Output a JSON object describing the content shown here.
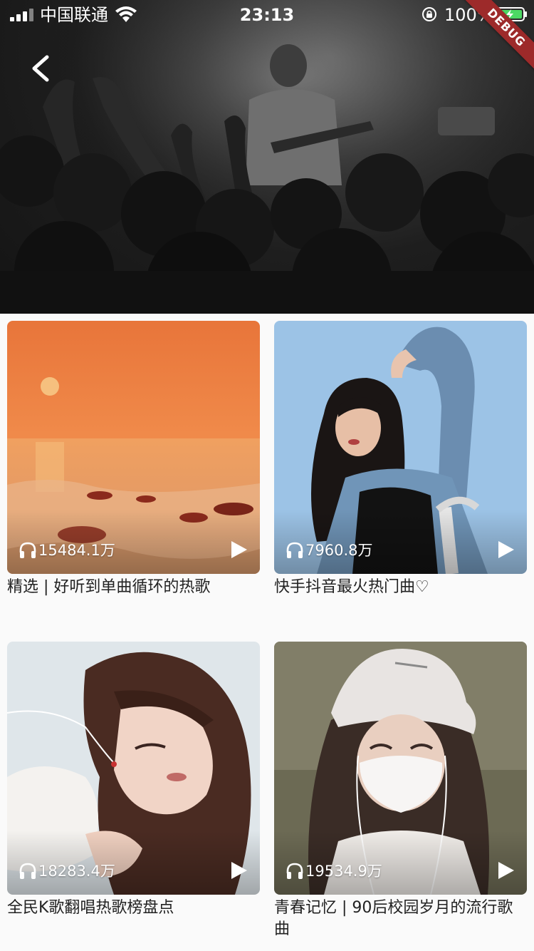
{
  "status_bar": {
    "carrier": "中国联通",
    "time": "23:13",
    "battery": "100%"
  },
  "debug_banner": "DEBUG",
  "header": {
    "back_icon": "chevron-left-icon"
  },
  "playlists": [
    {
      "title": "精选 | 好听到单曲循环的热歌",
      "play_count": "15484.1万"
    },
    {
      "title": "快手抖音最火热门曲♡",
      "play_count": "7960.8万"
    },
    {
      "title": "全民K歌翻唱热歌榜盘点",
      "play_count": "18283.4万"
    },
    {
      "title": "青春记忆 | 90后校园岁月的流行歌曲",
      "play_count": "19534.9万"
    }
  ],
  "colors": {
    "background": "#fafafa",
    "debug_ribbon": "#9d2a2a",
    "battery_fill": "#4cd964",
    "title_text": "#222222"
  }
}
